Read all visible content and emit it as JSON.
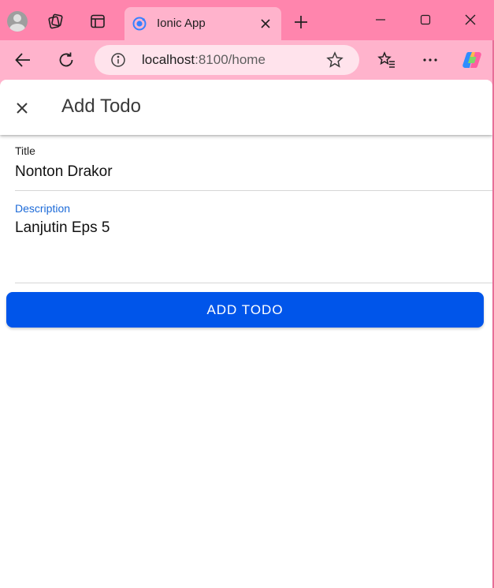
{
  "browser": {
    "tab": {
      "title": "Ionic App"
    },
    "url": {
      "host": "localhost",
      "path": ":8100/home"
    },
    "icons": {
      "profile": "profile-avatar-icon",
      "workspaces": "workspaces-icon",
      "tab_actions": "vertical-tabs-icon",
      "favicon": "ionic-logo-icon",
      "tab_close": "close-icon",
      "new_tab": "plus-icon",
      "minimize": "minimize-icon",
      "maximize": "maximize-icon",
      "window_close": "close-icon",
      "back": "back-arrow-icon",
      "refresh": "refresh-icon",
      "site_info": "info-icon",
      "favorite": "star-icon",
      "favorites": "favorites-list-icon",
      "more": "more-dots-icon",
      "copilot": "copilot-icon"
    }
  },
  "app": {
    "header": {
      "title": "Add Todo",
      "close_icon": "close-icon"
    },
    "form": {
      "title_field": {
        "label": "Title",
        "value": "Nonton Drakor"
      },
      "description_field": {
        "label": "Description",
        "value": "Lanjutin Eps 5"
      },
      "submit_label": "ADD TODO"
    },
    "colors": {
      "primary": "#0055ea",
      "focused_label": "#1c6ad8",
      "tabbar": "#ff85ad",
      "toolbar": "#ffb3cc"
    }
  }
}
